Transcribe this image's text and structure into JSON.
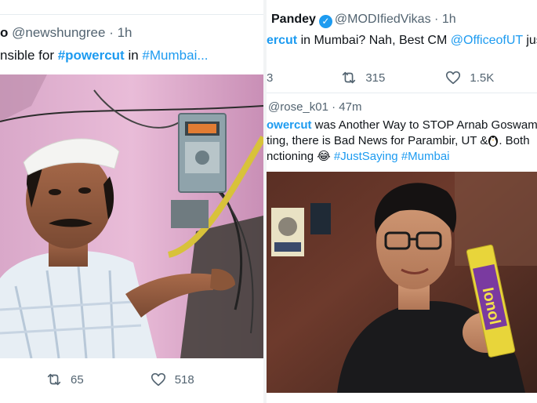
{
  "left_tweet": {
    "top_truncated": "",
    "author_prefix": "o",
    "handle": "@newshungree",
    "time": "1h",
    "text_prefix": "nsible for ",
    "hashtag1": "#powercut",
    "text_mid": " in ",
    "hashtag2": "#Mumbai...",
    "retweet_count": "65",
    "like_count": "518"
  },
  "right_tweet1": {
    "author_name": "Pandey",
    "handle": "@MODIfiedVikas",
    "time": "1h",
    "text_hashtag": "ercut",
    "text_rest": " in Mumbai? Nah, Best CM ",
    "mention": "@OfficeofUT",
    "text_tail": " just s",
    "line2_prefix": "",
    "reply_count": "3",
    "retweet_count": "315",
    "like_count": "1.5K"
  },
  "right_tweet2": {
    "handle": "@rose_k01",
    "time": "47m",
    "line1_hashtag": "owercut",
    "line1_rest": " was Another Way to STOP Arnab Goswami",
    "line2": "ting, there is Bad News for Parambir, UT &",
    "line2_tail": ". Both",
    "line3_prefix": "nctioning ",
    "line3_emoji": "😂",
    "hashtag_a": "#JustSaying",
    "hashtag_b": "#Mumbai",
    "product_label": "Ionol"
  },
  "colors": {
    "link": "#1d9bf0",
    "muted": "#536471",
    "text": "#0f1419"
  }
}
